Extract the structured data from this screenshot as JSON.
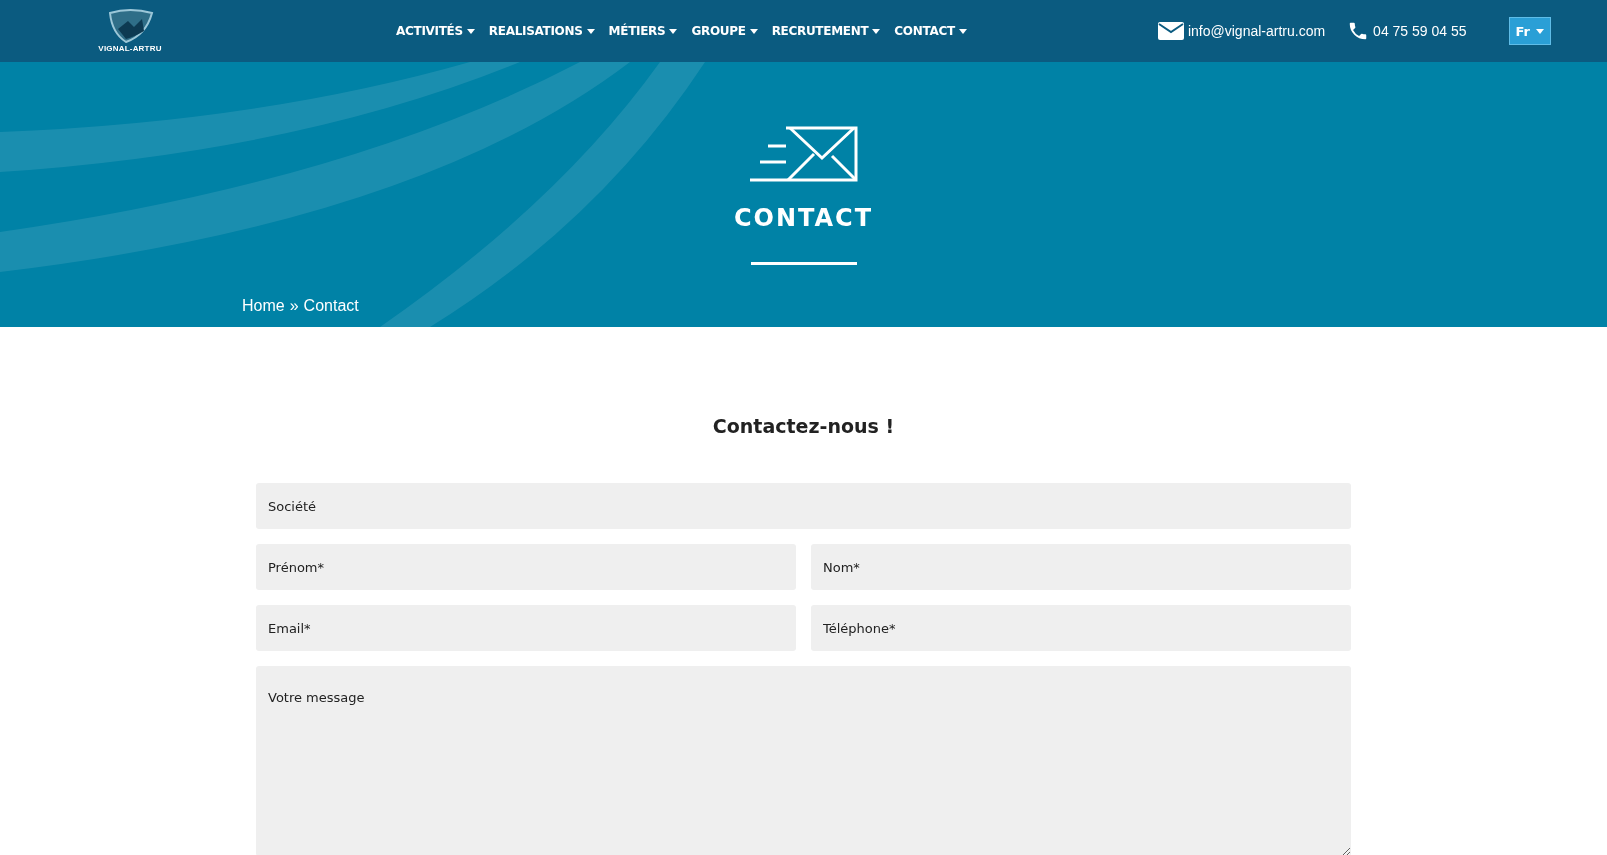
{
  "header": {
    "logo_text": "VIGNAL-ARTRU",
    "nav": [
      {
        "label": "ACTIVITÉS"
      },
      {
        "label": "REALISATIONS"
      },
      {
        "label": "MÉTIERS"
      },
      {
        "label": "GROUPE"
      },
      {
        "label": "RECRUTEMENT"
      },
      {
        "label": "CONTACT"
      }
    ],
    "email": "info@vignal-artru.com",
    "phone": "04 75 59 04 55",
    "language": "Fr"
  },
  "hero": {
    "title": "CONTACT",
    "breadcrumb": {
      "home": "Home",
      "separator": "»",
      "current": "Contact"
    }
  },
  "form": {
    "heading": "Contactez-nous !",
    "fields": [
      {
        "kind": "full",
        "placeholder": "Société"
      },
      {
        "kind": "half",
        "placeholder": "Prénom*"
      },
      {
        "kind": "half",
        "placeholder": "Nom*"
      },
      {
        "kind": "half",
        "placeholder": "Email*"
      },
      {
        "kind": "half",
        "placeholder": "Téléphone*"
      },
      {
        "kind": "textarea",
        "placeholder": "Votre message"
      }
    ]
  }
}
